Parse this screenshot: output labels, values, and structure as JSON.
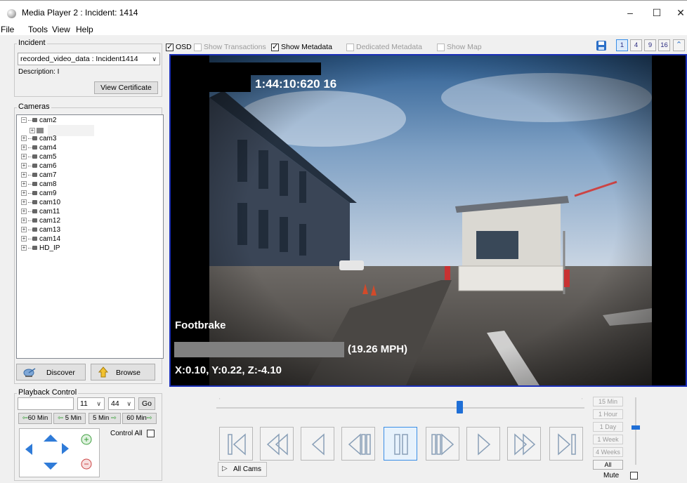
{
  "window": {
    "title": "Media Player 2 : Incident: 1414",
    "minimize": "–",
    "maximize": "☐",
    "close": "✕"
  },
  "menu": [
    "File",
    "Tools",
    "View",
    "Help"
  ],
  "incident": {
    "legend": "Incident",
    "selected": "recorded_video_data : Incident1414",
    "description_label": "Description:",
    "description_value": "I",
    "view_certificate": "View Certificate"
  },
  "cameras": {
    "legend": "Cameras",
    "tree": [
      "cam2",
      "cam3",
      "cam4",
      "cam5",
      "cam6",
      "cam7",
      "cam8",
      "cam9",
      "cam10",
      "cam11",
      "cam12",
      "cam13",
      "cam14",
      "HD_IP"
    ],
    "discover": "Discover",
    "browse": "Browse"
  },
  "toolbar": {
    "osd": "OSD",
    "show_transactions": "Show Transactions",
    "show_metadata": "Show Metadata",
    "dedicated_metadata": "Dedicated Metadata",
    "show_map": "Show Map",
    "layouts": [
      "1",
      "4",
      "9",
      "16"
    ]
  },
  "video": {
    "timestamp": "1:44:10:620 16",
    "footbrake": "Footbrake",
    "speed": "(19.26 MPH)",
    "accel": "X:0.10, Y:0.22, Z:-4.10"
  },
  "playback": {
    "legend": "Playback Control",
    "hour": "11",
    "minute": "44",
    "go": "Go",
    "back_60": "60 Min",
    "back_5": "5 Min",
    "fwd_5": "5 Min",
    "fwd_60": "60 Min",
    "control_all": "Control All",
    "all_cams": "All Cams",
    "ranges": [
      "15 Min",
      "1 Hour",
      "1 Day",
      "1 Week",
      "4 Weeks",
      "All"
    ],
    "mute": "Mute",
    "timeline_position": 0.66,
    "volume_level": 0.55
  },
  "colors": {
    "accent": "#1f6fd6",
    "video_border": "#1b2fb8",
    "brake_bar": "#808080"
  }
}
